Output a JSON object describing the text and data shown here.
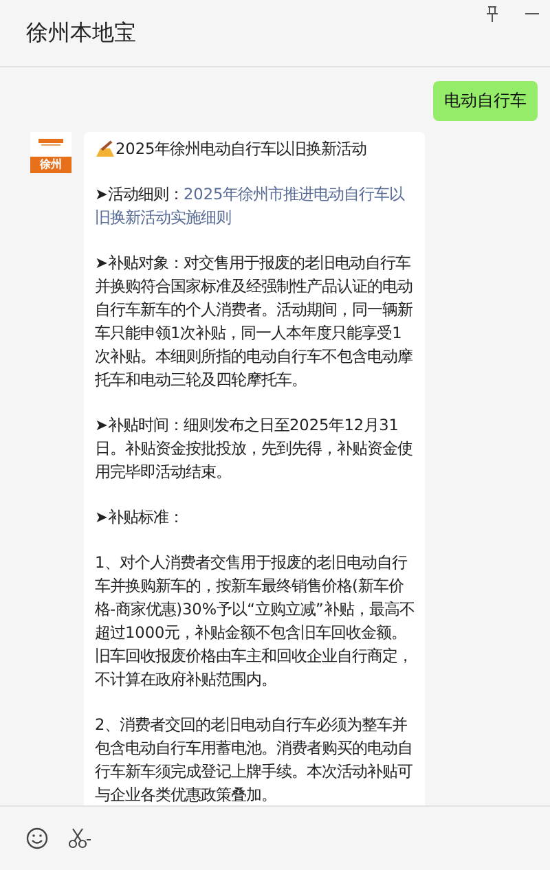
{
  "window": {
    "title": "徐州本地宝"
  },
  "sent_message": {
    "text": "电动自行车"
  },
  "reply": {
    "avatar_label": "徐州",
    "title": "2025年徐州电动自行车以旧换新活动",
    "paragraphs": [
      {
        "kind": "link",
        "text": "➤活动细则：",
        "link": "2025年徐州市推进电动自行车以旧换新活动实施细则"
      },
      {
        "kind": "text",
        "text": "➤补贴对象：对交售用于报废的老旧电动自行车并换购符合国家标准及经强制性产品认证的电动自行车新车的个人消费者。活动期间，同一辆新车只能申领1次补贴，同一人本年度只能享受1次补贴。本细则所指的电动自行车不包含电动摩托车和电动三轮及四轮摩托车。"
      },
      {
        "kind": "text",
        "text": "➤补贴时间：细则发布之日至2025年12月31日。补贴资金按批投放，先到先得，补贴资金使用完毕即活动结束。"
      },
      {
        "kind": "text",
        "text": "➤补贴标准："
      },
      {
        "kind": "text",
        "text": "1、对个人消费者交售用于报废的老旧电动自行车并换购新车的，按新车最终销售价格(新车价格-商家优惠)30%予以“立购立减”补贴，最高不超过1000元，补贴金额不包含旧车回收金额。旧车回收报废价格由车主和回收企业自行商定，不计算在政府补贴范围内。"
      },
      {
        "kind": "text",
        "text": "2、消费者交回的老旧电动自行车必须为整车并包含电动自行车用蓄电池。消费者购买的电动自行车新车须完成登记上牌手续。本次活动补贴可与企业各类优惠政策叠加。"
      }
    ]
  }
}
